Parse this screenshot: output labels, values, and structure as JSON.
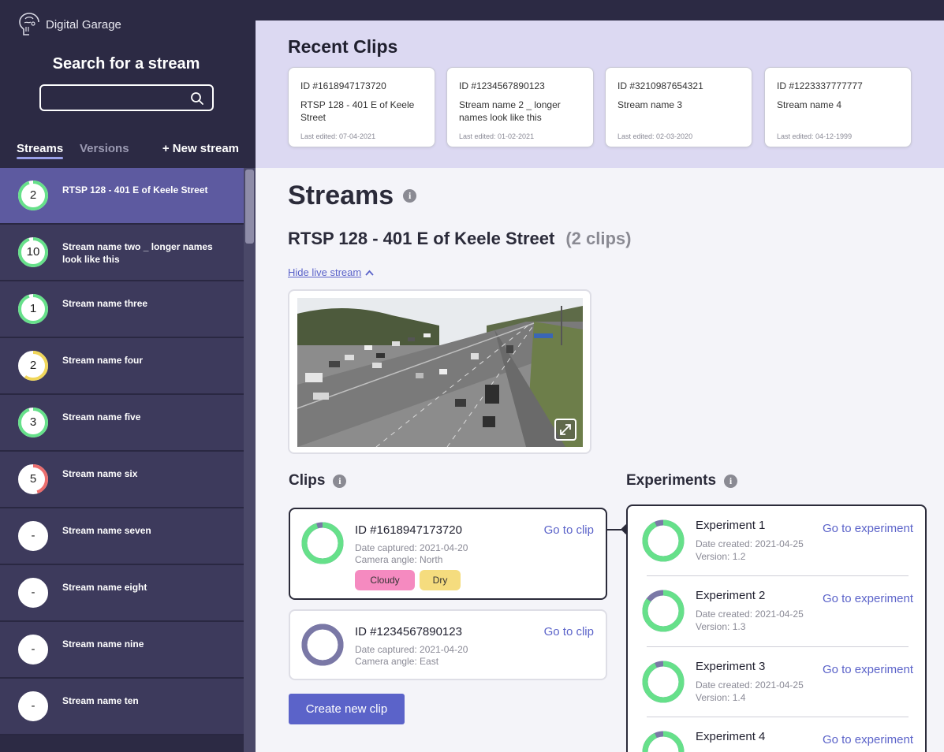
{
  "brand": {
    "name": "Digital Garage"
  },
  "sidebar": {
    "search_title": "Search for a stream",
    "search_placeholder": "",
    "tabs": {
      "streams": "Streams",
      "versions": "Versions"
    },
    "new_stream": "+ New stream",
    "items": [
      {
        "count": "2",
        "name": "RTSP 128 - 401 E of Keele Street",
        "ring_color": "#66e08a",
        "fill": 0.95,
        "active": true
      },
      {
        "count": "10",
        "name": "Stream name two _ longer names look like this",
        "ring_color": "#66e08a",
        "fill": 0.95
      },
      {
        "count": "1",
        "name": "Stream name three",
        "ring_color": "#66e08a",
        "fill": 0.95
      },
      {
        "count": "2",
        "name": "Stream name four",
        "ring_color": "#f0d65a",
        "fill": 0.6
      },
      {
        "count": "3",
        "name": "Stream name five",
        "ring_color": "#66e08a",
        "fill": 0.95
      },
      {
        "count": "5",
        "name": "Stream name six",
        "ring_color": "#ec6e6e",
        "fill": 0.45
      },
      {
        "count": "-",
        "name": "Stream name seven",
        "ring_color": "#ffffff",
        "fill": 0
      },
      {
        "count": "-",
        "name": "Stream name eight",
        "ring_color": "#ffffff",
        "fill": 0
      },
      {
        "count": "-",
        "name": "Stream name nine",
        "ring_color": "#ffffff",
        "fill": 0
      },
      {
        "count": "-",
        "name": "Stream name ten",
        "ring_color": "#ffffff",
        "fill": 0
      }
    ]
  },
  "recent": {
    "title": "Recent Clips",
    "cards": [
      {
        "id": "ID #1618947173720",
        "name": "RTSP 128 - 401 E of Keele Street",
        "edited": "Last edited: 07-04-2021"
      },
      {
        "id": "ID #1234567890123",
        "name": "Stream name 2 _ longer names look like this",
        "edited": "Last edited: 01-02-2021"
      },
      {
        "id": "ID #3210987654321",
        "name": "Stream name 3",
        "edited": "Last edited: 02-03-2020"
      },
      {
        "id": "ID #1223337777777",
        "name": "Stream name 4",
        "edited": "Last edited: 04-12-1999"
      }
    ]
  },
  "main": {
    "streams_title": "Streams",
    "stream_name": "RTSP 128 - 401 E of Keele Street",
    "clips_count": "(2 clips)",
    "hide_live": "Hide live stream",
    "clips_title": "Clips",
    "experiments_title": "Experiments",
    "create_clip": "Create new clip"
  },
  "clips": [
    {
      "id": "ID #1618947173720",
      "date": "Date captured: 2021-04-20",
      "angle": "Camera angle: North",
      "goto": "Go to clip",
      "tags": [
        "Cloudy",
        "Dry"
      ],
      "ring_color": "#66e08a",
      "fill": 0.95
    },
    {
      "id": "ID #1234567890123",
      "date": "Date captured: 2021-04-20",
      "angle": "Camera angle: East",
      "goto": "Go to clip",
      "ring_color": "#7a78a6",
      "fill": 1.0
    }
  ],
  "experiments": [
    {
      "name": "Experiment 1",
      "date": "Date created: 2021-04-25",
      "version": "Version: 1.2",
      "goto": "Go to experiment",
      "fill": 0.93
    },
    {
      "name": "Experiment 2",
      "date": "Date created: 2021-04-25",
      "version": "Version: 1.3",
      "goto": "Go to experiment",
      "fill": 0.85
    },
    {
      "name": "Experiment 3",
      "date": "Date created: 2021-04-25",
      "version": "Version: 1.4",
      "goto": "Go to experiment",
      "fill": 0.93
    },
    {
      "name": "Experiment 4",
      "date": "",
      "version": "",
      "goto": "Go to experiment",
      "fill": 0.93
    }
  ],
  "colors": {
    "accent": "#5b63c9",
    "sidebar_bg": "#2c2a44",
    "active_item": "#5d5aa0",
    "ring_green": "#66e08a",
    "ring_track": "#7a78a6"
  }
}
